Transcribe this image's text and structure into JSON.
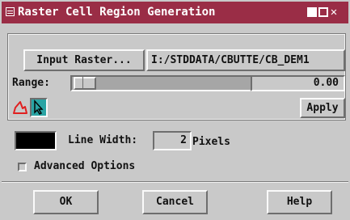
{
  "window": {
    "title": "Raster Cell Region Generation"
  },
  "input_raster": {
    "button_label": "Input Raster...",
    "path": "I:/STDDATA/CBUTTE/CB_DEM1"
  },
  "range": {
    "label": "Range:",
    "value": "0.00",
    "slider_position": 0.0
  },
  "tools": {
    "apply_label": "Apply"
  },
  "line": {
    "color": "#000000",
    "width_label": "Line Width:",
    "width_value": "2",
    "units": "Pixels"
  },
  "advanced": {
    "label": "Advanced Options",
    "checked": false
  },
  "footer": {
    "ok_label": "OK",
    "cancel_label": "Cancel",
    "help_label": "Help"
  },
  "colors": {
    "titlebar": "#9a2d46",
    "background": "#c9c9c9",
    "accent_tool": "#2aa4a4",
    "polygon_icon": "#e02020"
  }
}
